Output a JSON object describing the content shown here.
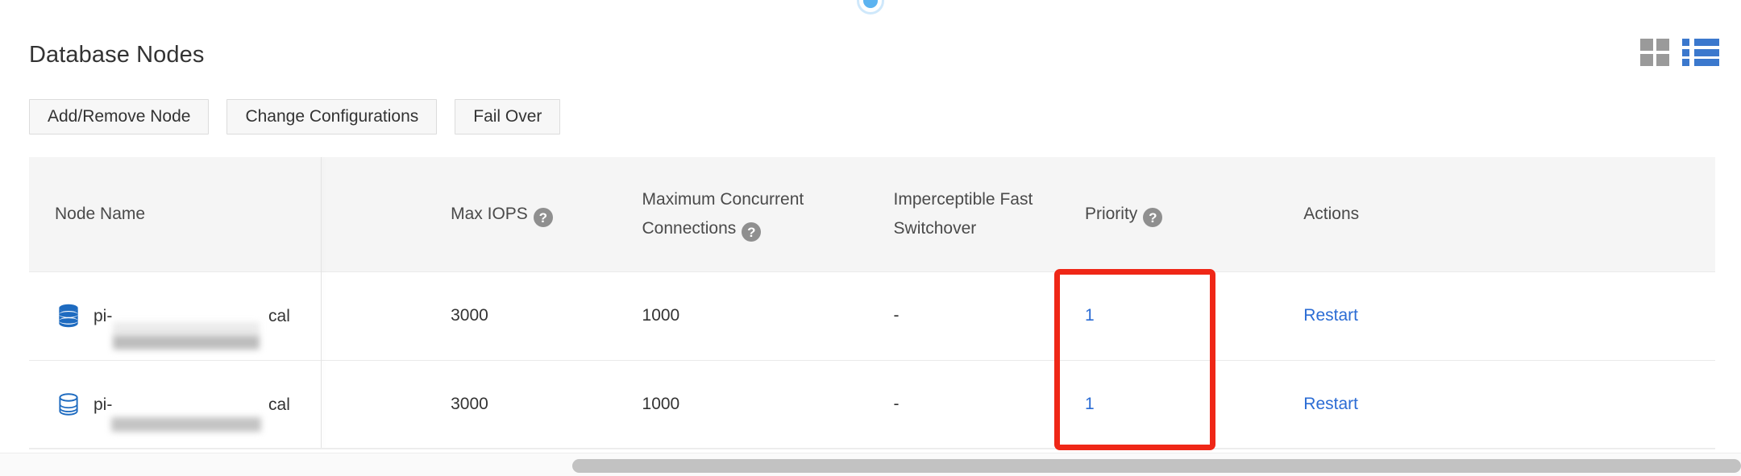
{
  "panel": {
    "title": "Database Nodes"
  },
  "view_toggle": {
    "grid_icon": "grid-view-icon",
    "list_icon": "list-view-icon",
    "active": "list",
    "grid_color": "#9a9a9a",
    "list_color": "#3b78cd"
  },
  "top_indicator": {
    "icon": "circle-indicator",
    "ring_color": "#cfe8fb",
    "dot_color": "#5cb3f0"
  },
  "buttons": [
    {
      "label": "Add/Remove Node"
    },
    {
      "label": "Change Configurations"
    },
    {
      "label": "Fail Over"
    }
  ],
  "table": {
    "columns": [
      {
        "label": "Node Name",
        "help": false
      },
      {
        "label": "Max IOPS",
        "help": true
      },
      {
        "label": "Maximum Concurrent Connections",
        "help": true
      },
      {
        "label": "Imperceptible Fast Switchover",
        "help": false
      },
      {
        "label": "Priority",
        "help": true
      },
      {
        "label": "Actions",
        "help": false
      }
    ],
    "help_glyph": "?",
    "rows": [
      {
        "icon": "database-primary-icon",
        "node_name_prefix": "pi-",
        "node_name_suffix": "cal",
        "node_name_redacted": true,
        "max_iops": "3000",
        "max_connections": "1000",
        "fast_switchover": "-",
        "priority": "1",
        "action": "Restart"
      },
      {
        "icon": "database-replica-icon",
        "node_name_prefix": "pi-",
        "node_name_suffix": "cal",
        "node_name_redacted": true,
        "max_iops": "3000",
        "max_connections": "1000",
        "fast_switchover": "-",
        "priority": "1",
        "action": "Restart"
      }
    ]
  },
  "annotation": {
    "shape": "rectangle",
    "target": "priority-column-values",
    "color": "#ef2717"
  },
  "scrollbar": {
    "orientation": "horizontal",
    "thumb_color": "#c2c2c2"
  },
  "colors": {
    "link": "#2b6cd4",
    "header_bg": "#f5f5f5",
    "text": "#333333"
  }
}
